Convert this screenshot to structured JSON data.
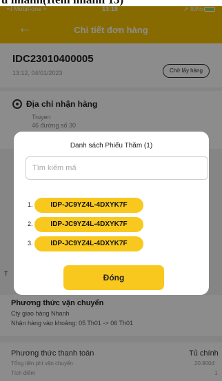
{
  "caption": "u nhánh(Item nhánh 13)",
  "status_bar": {
    "carrier": "MobiFone",
    "time": "13:18",
    "battery": "93%"
  },
  "header": {
    "back_icon": "back-arrow-icon",
    "title": "Chi tiết đơn hàng"
  },
  "order": {
    "code": "IDC23010400005",
    "datetime": "13:12, 04/01/2023",
    "status": "Chờ lấy hàng"
  },
  "address": {
    "icon": "location-pin-icon",
    "title": "Địa chỉ nhận hàng",
    "name": "Truyen",
    "line": "46 đường số 30"
  },
  "modal": {
    "title": "Danh sách Phiếu Thăm (1)",
    "search_placeholder": "Tìm kiếm mã",
    "items": [
      {
        "index": "1.",
        "code": "IDP-JC9YZ4L-4DXYK7F"
      },
      {
        "index": "2.",
        "code": "IDP-JC9YZ4L-4DXYK7F"
      },
      {
        "index": "3.",
        "code": "IDP-JC9YZ4L-4DXYK7F"
      }
    ],
    "close_label": "Đóng"
  },
  "side_fragment": "T",
  "shipping": {
    "title": "Phương thức vận chuyển",
    "method": "Cty giao hàng Nhanh",
    "receive_time": "Nhận hàng vào khoảng: 05 Th01 -> 06 Th01"
  },
  "payment": {
    "title": "Phương thức thanh toán",
    "method": "Tủ chính",
    "total_label": "Tổng tiền phí vận chuyển",
    "total_value": "20.900đ",
    "points_label": "Tích điểm",
    "points_value": "1"
  },
  "colors": {
    "brand_yellow": "#f7c300",
    "chip_yellow": "#f8c81e",
    "overlay": "rgba(0,0,0,0.45)"
  }
}
